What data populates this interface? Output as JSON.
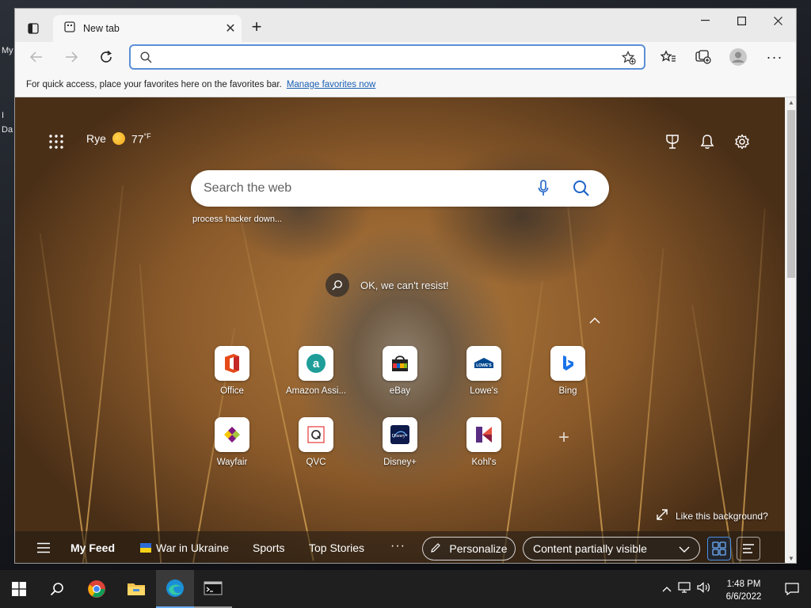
{
  "desktop": {
    "fragments": [
      "My",
      "I",
      "Da"
    ]
  },
  "browser": {
    "tab": {
      "title": "New tab"
    },
    "address": {
      "value": "",
      "placeholder": ""
    },
    "favorites_bar": {
      "message": "For quick access, place your favorites here on the favorites bar.",
      "link": "Manage favorites now"
    }
  },
  "ntp": {
    "weather": {
      "location": "Rye",
      "temperature": "77",
      "unit": "°F"
    },
    "search": {
      "placeholder": "Search the web"
    },
    "trending": "process hacker down...",
    "bg_query": "OK, we can't resist!",
    "tiles": [
      {
        "label": "Office",
        "icon": "office-icon"
      },
      {
        "label": "Amazon Assi...",
        "icon": "amazon-icon"
      },
      {
        "label": "eBay",
        "icon": "ebay-icon"
      },
      {
        "label": "Lowe's",
        "icon": "lowes-icon"
      },
      {
        "label": "Bing",
        "icon": "bing-icon"
      },
      {
        "label": "Wayfair",
        "icon": "wayfair-icon"
      },
      {
        "label": "QVC",
        "icon": "qvc-icon"
      },
      {
        "label": "Disney+",
        "icon": "disney-plus-icon"
      },
      {
        "label": "Kohl's",
        "icon": "kohls-icon"
      }
    ],
    "like_background": "Like this background?",
    "feed": {
      "items": [
        "My Feed",
        "War in Ukraine",
        "Sports",
        "Top Stories"
      ],
      "more": "···",
      "personalize": "Personalize",
      "content_visibility": "Content partially visible"
    }
  },
  "taskbar": {
    "time": "1:48 PM",
    "date": "6/6/2022"
  },
  "colors": {
    "accent": "#5b8fd6",
    "link": "#1a5fb4"
  }
}
